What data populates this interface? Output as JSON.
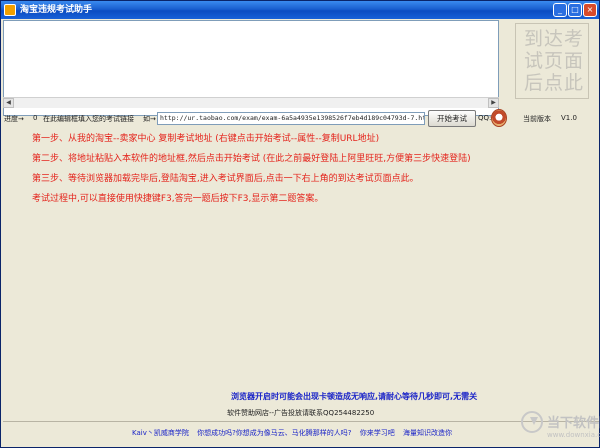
{
  "window": {
    "title": "淘宝违规考试助手",
    "minimize_glyph": "_",
    "maximize_glyph": "□",
    "close_glyph": "×"
  },
  "answer_button": {
    "label": "到达考试页面后点此"
  },
  "scrollbar": {
    "left_arrow": "◀",
    "right_arrow": "▶"
  },
  "toolbar": {
    "progress_label": "进度→",
    "progress_value": "0",
    "instruction": "在此编辑框填入您的考试链接",
    "url_prefix": "如→",
    "url_value": "http://ur.taobao.com/exam/exam-6a5a4935e1398526f7eb4d189c04793d-7.htm",
    "start_button": "开始考试",
    "qq_label": "QQ:",
    "version_label": "当前版本",
    "version_value": "V1.0"
  },
  "steps": [
    "第一步、从我的淘宝--卖家中心 复制考试地址 (右键点击开始考试--属性--复制URL地址)",
    "第二步、将地址粘贴入本软件的地址框,然后点击开始考试 (在此之前最好登陆上阿里旺旺,方便第三步快速登陆)",
    "第三步、等待浏览器加载完毕后,登陆淘宝,进入考试界面后,点击一下右上角的到达考试页面点此。",
    "考试过程中,可以直接使用快捷键F3,答完一题后按下F3,显示第二题答案。"
  ],
  "notice": "浏览器开启时可能会出现卡顿造成无响应,请耐心等待几秒即可,无需关",
  "sponsor": "软件赞助网店--广告投放请联系QQ254482250",
  "footer_links": [
    "Kaiv丶凯威商学院",
    "你想成功吗?你想成为像马云、马化腾那样的人吗?",
    "你来学习吧",
    "海量知识改造你"
  ],
  "watermark": {
    "name": "当下软件园",
    "url": "www.downxia.com"
  },
  "colors": {
    "step_red": "#e4241c",
    "notice_blue": "#1a24c8",
    "title_blue": "#0b4cc2"
  }
}
